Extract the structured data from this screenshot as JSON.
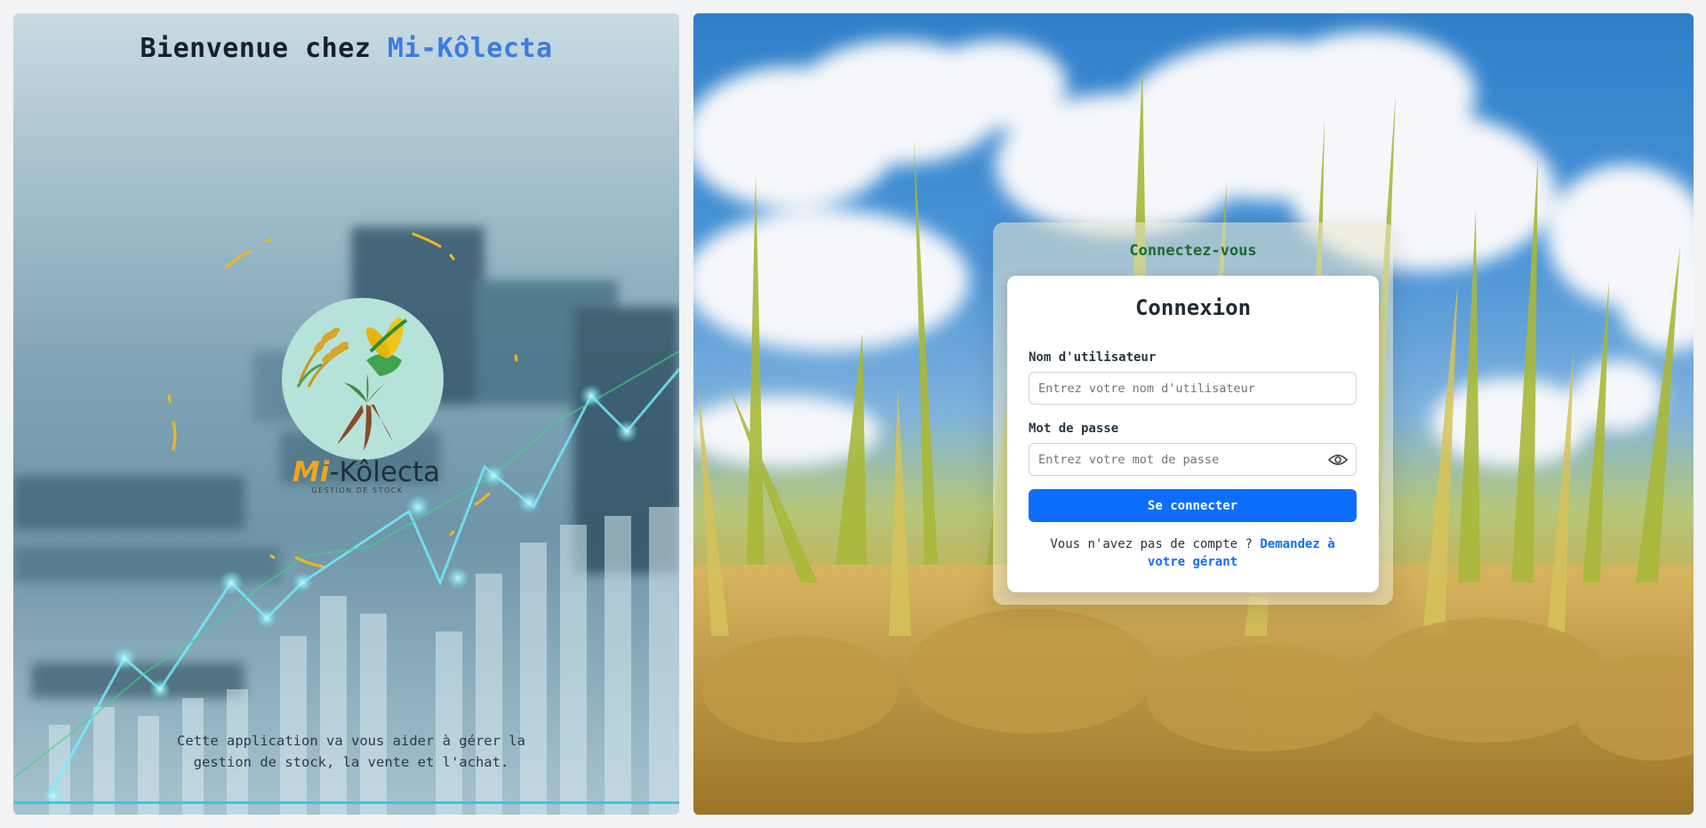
{
  "left": {
    "title_prefix": "Bienvenue chez ",
    "title_brand": "Mi-Kôlecta",
    "logo": {
      "brand_mi": "Mi",
      "brand_rest": "-Kôlecta",
      "subtitle": "GESTION DE STOCK"
    },
    "description": "Cette application va vous aider à gérer la gestion de stock, la vente et l'achat."
  },
  "login": {
    "panel_title": "Connectez-vous",
    "card_title": "Connexion",
    "username_label": "Nom d'utilisateur",
    "username_placeholder": "Entrez votre nom d'utilisateur",
    "password_label": "Mot de passe",
    "password_placeholder": "Entrez votre mot de passe",
    "submit_label": "Se connecter",
    "signup_text": "Vous n'avez pas de compte ? ",
    "signup_link": "Demandez à votre gérant"
  },
  "colors": {
    "brand_blue": "#3b7de0",
    "primary_button": "#0d6efd",
    "panel_title_green": "#1d6a2e",
    "logo_circle": "#b6e3d9",
    "logo_accent": "#f2a51f"
  },
  "icons": {
    "password_toggle": "eye-icon"
  }
}
